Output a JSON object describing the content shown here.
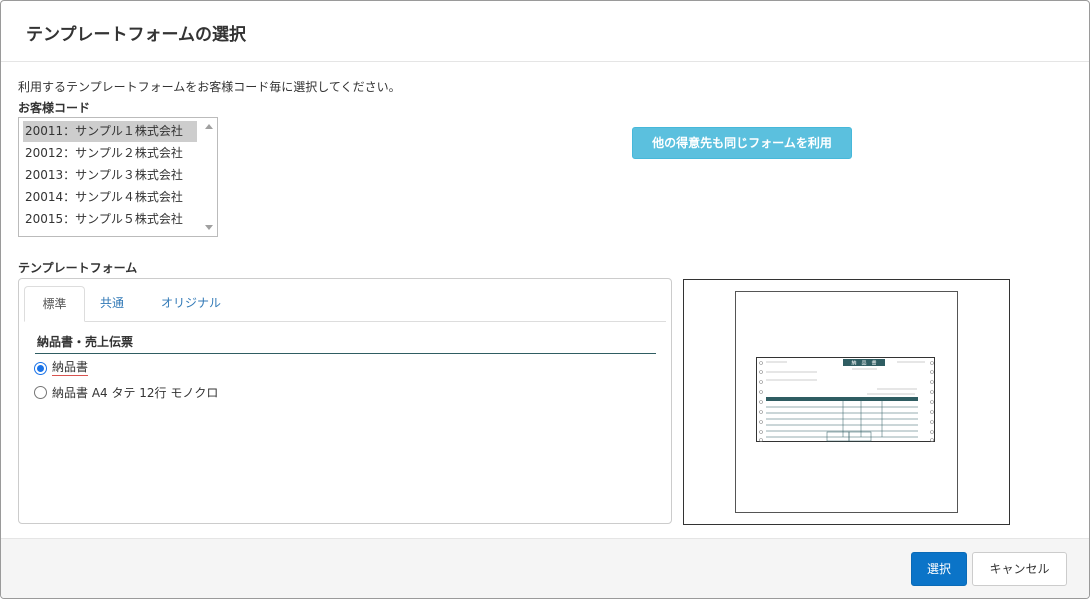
{
  "dialog": {
    "title": "テンプレートフォームの選択",
    "instruction": "利用するテンプレートフォームをお客様コード毎に選択してください。"
  },
  "customer": {
    "label": "お客様コード",
    "items": [
      {
        "text": "20011：サンプル１株式会社",
        "selected": true
      },
      {
        "text": "20012：サンプル２株式会社",
        "selected": false
      },
      {
        "text": "20013：サンプル３株式会社",
        "selected": false
      },
      {
        "text": "20014：サンプル４株式会社",
        "selected": false
      },
      {
        "text": "20015：サンプル５株式会社",
        "selected": false
      }
    ],
    "same_form_button": "他の得意先も同じフォームを利用"
  },
  "template": {
    "label": "テンプレートフォーム",
    "tabs": [
      {
        "label": "標準",
        "active": true
      },
      {
        "label": "共通",
        "active": false
      },
      {
        "label": "オリジナル",
        "active": false
      }
    ],
    "section_title": "納品書・売上伝票",
    "options": [
      {
        "label": "納品書",
        "checked": true
      },
      {
        "label": "納品書 A4 タテ 12行 モノクロ",
        "checked": false
      }
    ]
  },
  "preview": {
    "slip_title": "納　品　書",
    "accent_color": "#2f5d62"
  },
  "footer": {
    "select_label": "選択",
    "cancel_label": "キャンセル"
  }
}
